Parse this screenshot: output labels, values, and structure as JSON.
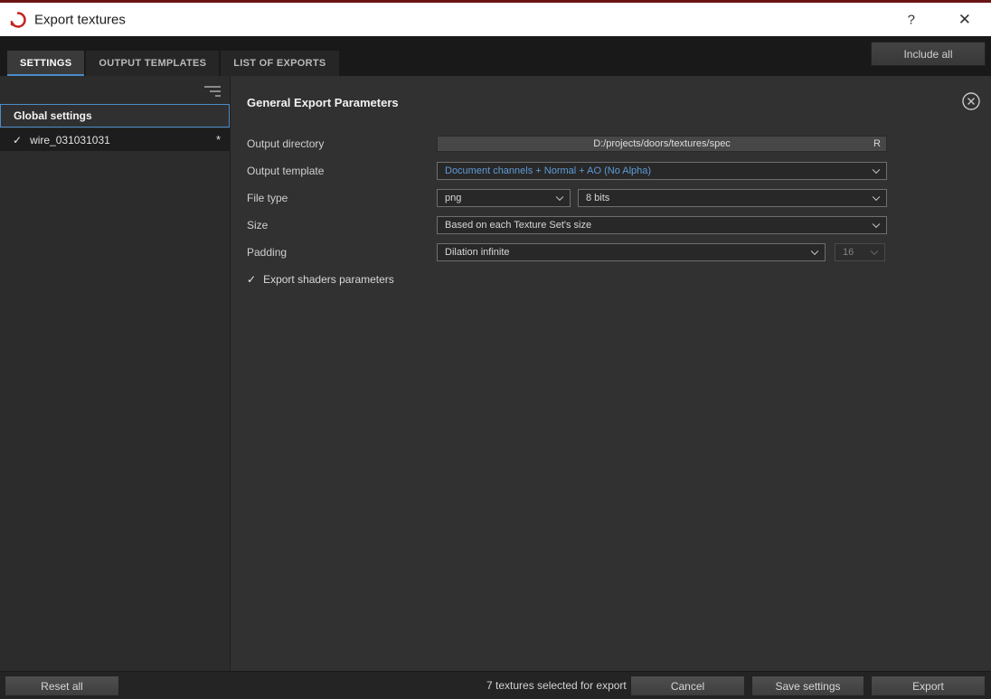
{
  "window": {
    "title": "Export textures",
    "help": "?",
    "close": "✕"
  },
  "tabs": [
    {
      "label": "SETTINGS"
    },
    {
      "label": "OUTPUT TEMPLATES"
    },
    {
      "label": "LIST OF EXPORTS"
    }
  ],
  "include_all": "Include all",
  "sidebar": {
    "items": [
      {
        "label": "Global settings"
      },
      {
        "label": "wire_031031031",
        "check": "✓",
        "modified": "*"
      }
    ]
  },
  "panel": {
    "title": "General Export Parameters",
    "output_directory": {
      "label": "Output directory",
      "value": "D:/projects/doors/textures/spec",
      "reset": "R"
    },
    "output_template": {
      "label": "Output template",
      "value": "Document channels + Normal + AO (No Alpha)"
    },
    "file_type": {
      "label": "File type",
      "format": "png",
      "bit_depth": "8 bits"
    },
    "size": {
      "label": "Size",
      "value": "Based on each Texture Set's size"
    },
    "padding": {
      "label": "Padding",
      "value": "Dilation infinite",
      "pixels": "16"
    },
    "export_shaders": {
      "label": "Export shaders parameters",
      "check": "✓"
    }
  },
  "footer": {
    "reset_all": "Reset all",
    "status": "7 textures selected for export",
    "cancel": "Cancel",
    "save_settings": "Save settings",
    "export": "Export"
  },
  "colors": {
    "accent-blue": "#4a8cc7",
    "template-blue": "#5f9bd6",
    "logo-red": "#c32222"
  }
}
